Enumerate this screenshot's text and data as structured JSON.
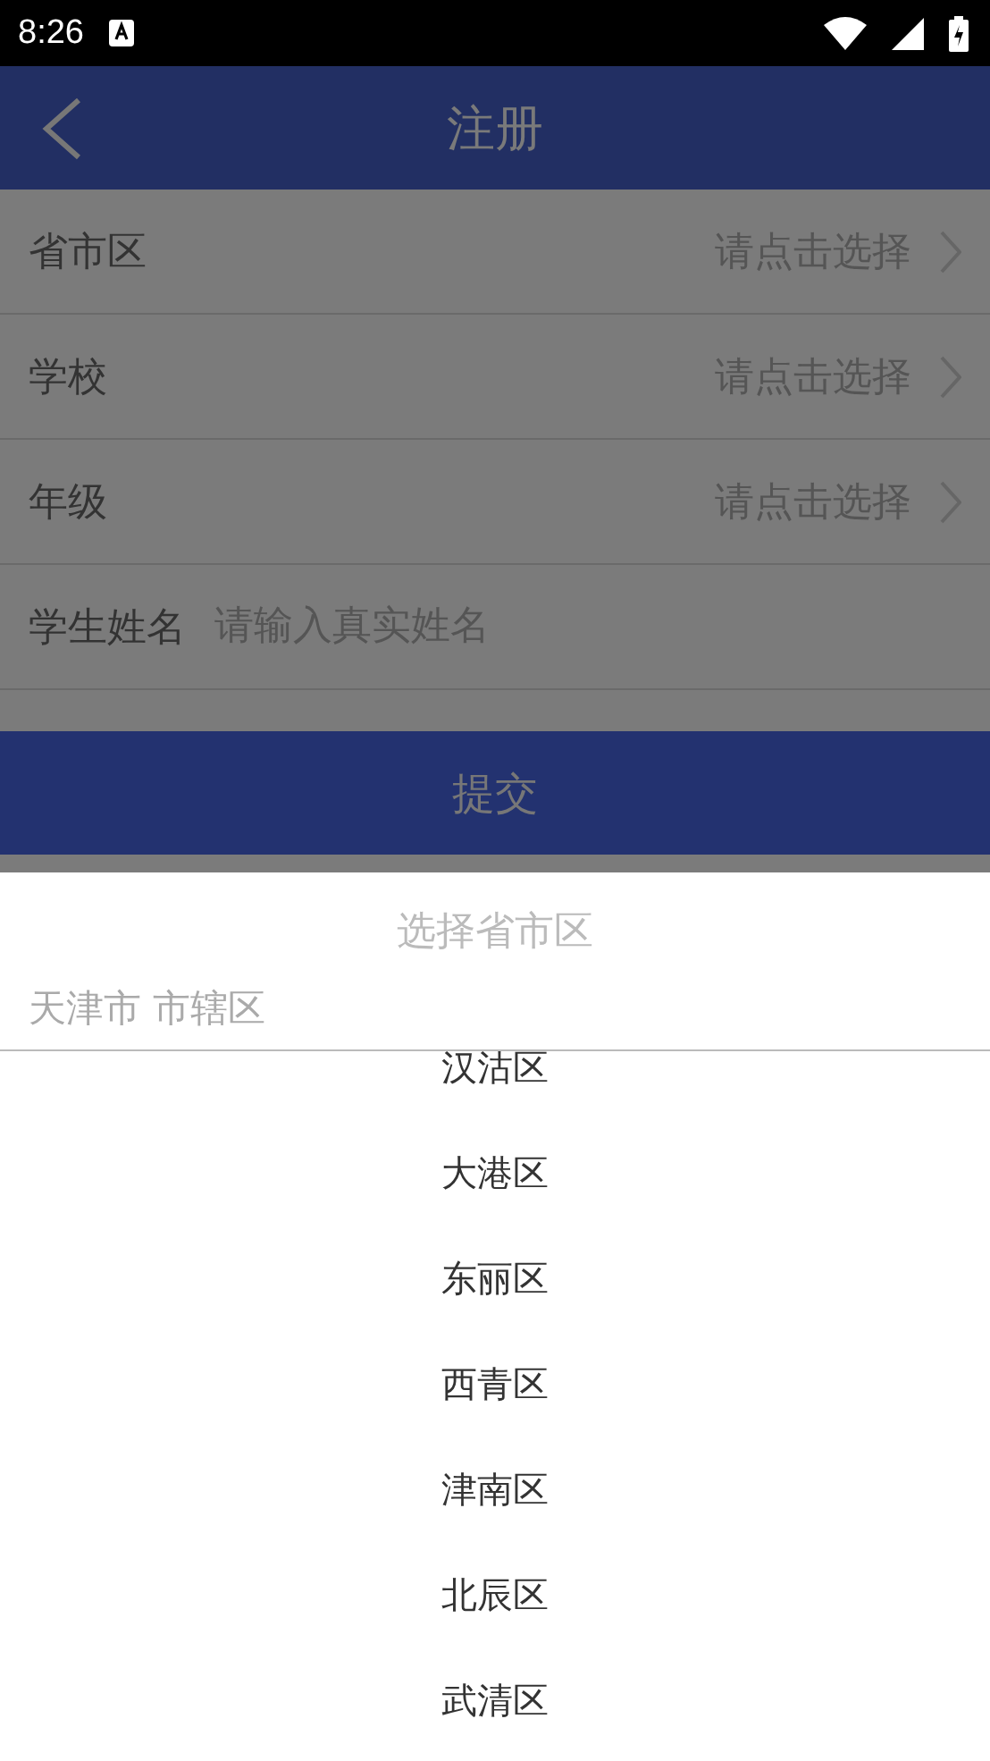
{
  "status_bar": {
    "time": "8:26"
  },
  "header": {
    "title": "注册"
  },
  "form_rows": [
    {
      "kind": "select",
      "label": "省市区",
      "placeholder": "请点击选择"
    },
    {
      "kind": "select",
      "label": "学校",
      "placeholder": "请点击选择"
    },
    {
      "kind": "select",
      "label": "年级",
      "placeholder": "请点击选择"
    },
    {
      "kind": "input",
      "label": "学生姓名",
      "placeholder": "请输入真实姓名"
    }
  ],
  "submit_button": "提交",
  "picker": {
    "title": "选择省市区",
    "path": "天津市 市辖区",
    "options": [
      "汉沽区",
      "大港区",
      "东丽区",
      "西青区",
      "津南区",
      "北辰区",
      "武清区"
    ]
  }
}
